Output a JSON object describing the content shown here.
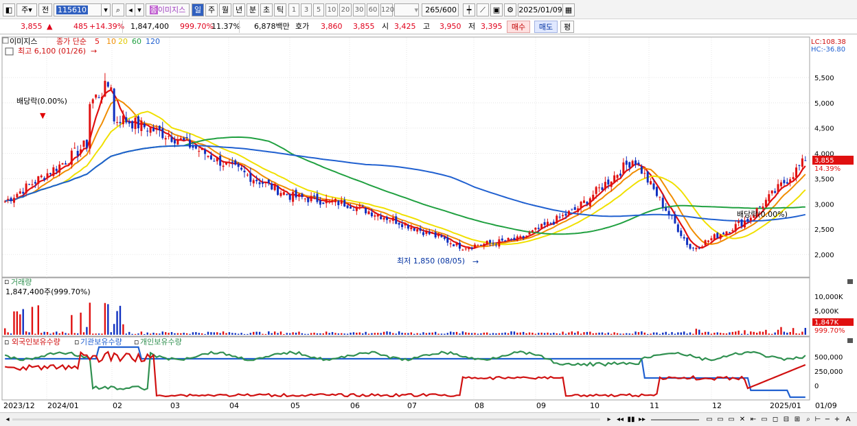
{
  "toolbar": {
    "period_select": "주",
    "prev_label": "전",
    "code": "115610",
    "stock_name": "이미지스",
    "stock_badge": "종",
    "periods": [
      "일",
      "주",
      "월",
      "년",
      "분",
      "초",
      "틱"
    ],
    "active_period": "일",
    "intervals": [
      "1",
      "3",
      "5",
      "10",
      "20",
      "30",
      "60",
      "120"
    ],
    "count": "265",
    "count_total": "/600",
    "date": "2025/01/09"
  },
  "pricebar": {
    "price": "3,855",
    "change_arrow": "▲",
    "change": "485",
    "change_pct": "+14.39%",
    "volume": "1,847,400",
    "volume_ratio": "999.70%",
    "turnover": "11.37%",
    "amount": "6,878백만",
    "quote_label": "호가",
    "quote_ask": "3,860",
    "quote_bid": "3,855",
    "open_label": "시",
    "open": "3,425",
    "high_label": "고",
    "high": "3,950",
    "low_label": "저",
    "low": "3,395",
    "buy_button": "매수",
    "sell_button": "매도",
    "eval_button": "평"
  },
  "price_panel": {
    "legend_name": "이미지스",
    "ma_label": "종가 단순",
    "ma_periods": [
      "5",
      "10",
      "20",
      "60",
      "120"
    ],
    "ma_colors": [
      "#e01010",
      "#f08c00",
      "#f0e000",
      "#20a040",
      "#2060d0"
    ],
    "high_note": "최고 6,100 (01/26)",
    "low_note": "최저 1,850 (08/05)",
    "dividend_note": "배당락(0.00%)",
    "dividend_note2": "배당락(0.00%)",
    "lc_label": "LC:108.38",
    "hc_label": "HC:-36.80",
    "current_price_tag": "3,855",
    "current_pct_tag": "14.39%",
    "y_ticks": [
      "5,500",
      "5,000",
      "4,500",
      "4,000",
      "3,500",
      "3,000",
      "2,500",
      "2,000"
    ]
  },
  "volume_panel": {
    "title": "거래량",
    "current_volume": "1,847,400주(999.70%)",
    "y_ticks": [
      "10,000K",
      "5,000K"
    ],
    "tag_value": "1,847K",
    "tag_pct": "999.70%"
  },
  "holding_panel": {
    "titles": [
      "외국인보유수량",
      "기관보유수량",
      "개인보유수량"
    ],
    "title_colors": [
      "#d01010",
      "#2060d0",
      "#309050"
    ],
    "y_ticks": [
      "500,000",
      "250,000",
      "0"
    ]
  },
  "x_axis": {
    "labels": [
      "2023/12",
      "2024/01",
      "02",
      "03",
      "04",
      "05",
      "06",
      "07",
      "08",
      "09",
      "10",
      "11",
      "12",
      "2025/01",
      "01/09"
    ]
  },
  "chart_data": {
    "type": "candlestick",
    "x": [
      "2023/12",
      "2024/01",
      "02",
      "03",
      "04",
      "05",
      "06",
      "07",
      "08",
      "09",
      "10",
      "11",
      "12",
      "2025/01"
    ],
    "close_approx": [
      3050,
      3800,
      4700,
      4300,
      3700,
      3150,
      3000,
      2600,
      2150,
      2300,
      2900,
      3900,
      2100,
      2700
    ],
    "last_close": 3855,
    "high": 6100,
    "high_date": "01/26",
    "low": 1850,
    "low_date": "08/05",
    "ylim": [
      1850,
      6100
    ]
  }
}
